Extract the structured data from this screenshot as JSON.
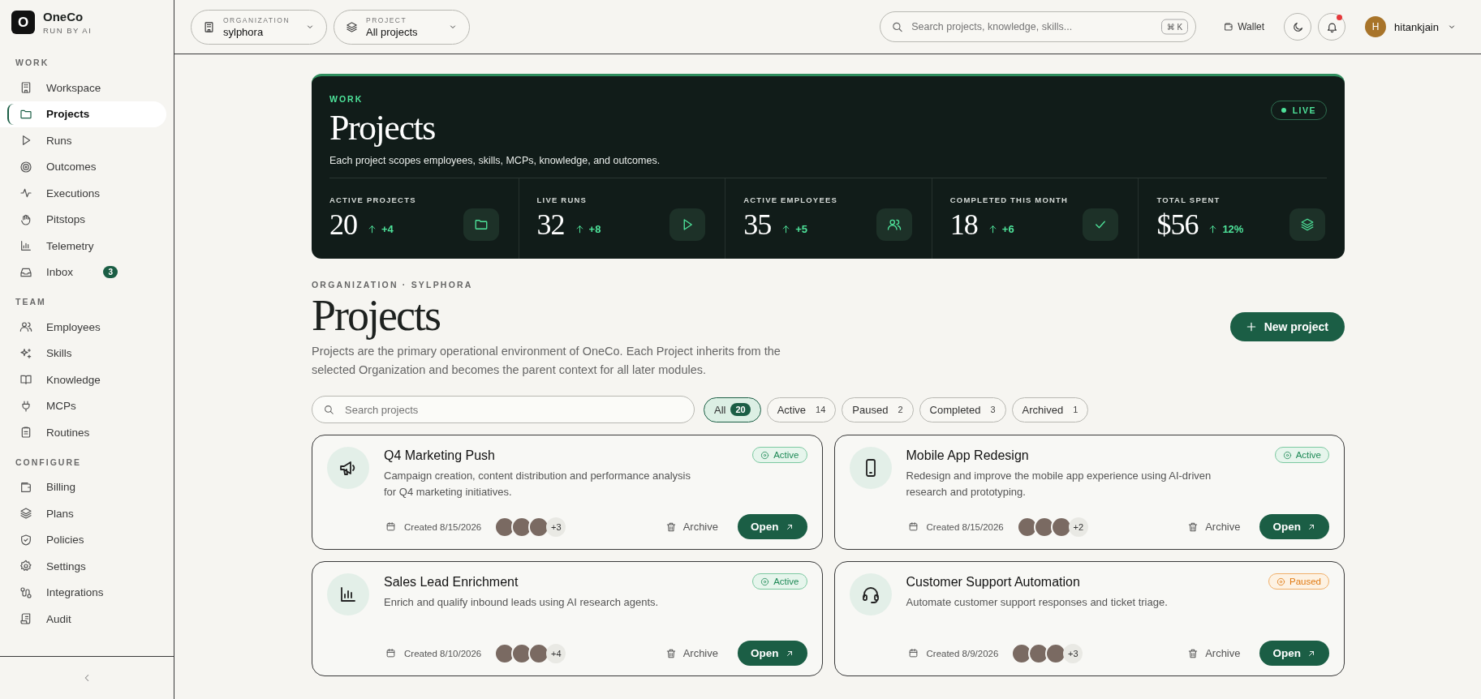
{
  "brand": {
    "name": "OneCo",
    "tagline": "RUN BY AI",
    "logo_letter": "O"
  },
  "sidebar": {
    "sections": [
      {
        "title": "WORK",
        "items": [
          {
            "label": "Workspace",
            "selected": false
          },
          {
            "label": "Projects",
            "selected": true
          },
          {
            "label": "Runs",
            "selected": false
          },
          {
            "label": "Outcomes",
            "selected": false
          },
          {
            "label": "Executions",
            "selected": false
          },
          {
            "label": "Pitstops",
            "selected": false
          },
          {
            "label": "Telemetry",
            "selected": false
          },
          {
            "label": "Inbox",
            "selected": false,
            "badge": "3"
          }
        ]
      },
      {
        "title": "TEAM",
        "items": [
          {
            "label": "Employees",
            "selected": false
          },
          {
            "label": "Skills",
            "selected": false
          },
          {
            "label": "Knowledge",
            "selected": false
          },
          {
            "label": "MCPs",
            "selected": false
          },
          {
            "label": "Routines",
            "selected": false
          }
        ]
      },
      {
        "title": "CONFIGURE",
        "items": [
          {
            "label": "Billing",
            "selected": false
          },
          {
            "label": "Plans",
            "selected": false
          },
          {
            "label": "Policies",
            "selected": false
          },
          {
            "label": "Settings",
            "selected": false
          },
          {
            "label": "Integrations",
            "selected": false
          },
          {
            "label": "Audit",
            "selected": false
          }
        ]
      }
    ]
  },
  "topbar": {
    "organization": {
      "label": "ORGANIZATION",
      "value": "sylphora"
    },
    "project": {
      "label": "PROJECT",
      "value": "All projects"
    },
    "search": {
      "placeholder": "Search projects, knowledge, skills...",
      "shortcut": "⌘ K"
    },
    "wallet": "Wallet",
    "notifications_unread": true,
    "user": {
      "initial": "H",
      "name": "hitankjain"
    }
  },
  "hero": {
    "eyebrow": "WORK",
    "title": "Projects",
    "subtitle": "Each project scopes employees, skills, MCPs, knowledge, and outcomes.",
    "live": "LIVE",
    "stats": [
      {
        "label": "ACTIVE PROJECTS",
        "value": "20",
        "delta": "+4"
      },
      {
        "label": "LIVE RUNS",
        "value": "32",
        "delta": "+8"
      },
      {
        "label": "ACTIVE EMPLOYEES",
        "value": "35",
        "delta": "+5"
      },
      {
        "label": "COMPLETED THIS MONTH",
        "value": "18",
        "delta": "+6"
      },
      {
        "label": "TOTAL SPENT",
        "value": "$56",
        "delta": "12%"
      }
    ]
  },
  "page": {
    "breadcrumb": "ORGANIZATION · SYLPHORA",
    "title": "Projects",
    "description": "Projects are the primary operational environment of OneCo. Each Project inherits from the selected Organization and becomes the parent context for all later modules.",
    "new_button": "New project"
  },
  "search": {
    "placeholder": "Search projects"
  },
  "filters": [
    {
      "label": "All",
      "count": "20",
      "selected": true
    },
    {
      "label": "Active",
      "count": "14",
      "selected": false
    },
    {
      "label": "Paused",
      "count": "2",
      "selected": false
    },
    {
      "label": "Completed",
      "count": "3",
      "selected": false
    },
    {
      "label": "Archived",
      "count": "1",
      "selected": false
    }
  ],
  "projects": [
    {
      "title": "Q4 Marketing Push",
      "description": "Campaign creation, content distribution and performance analysis for Q4 marketing initiatives.",
      "status": "Active",
      "kind": "active",
      "created": "Created 8/15/2026",
      "more": "+3",
      "archive": "Archive",
      "open": "Open"
    },
    {
      "title": "Mobile App Redesign",
      "description": "Redesign and improve the mobile app experience using AI-driven research and prototyping.",
      "status": "Active",
      "kind": "active",
      "created": "Created 8/15/2026",
      "more": "+2",
      "archive": "Archive",
      "open": "Open"
    },
    {
      "title": "Sales Lead Enrichment",
      "description": "Enrich and qualify inbound leads using AI research agents.",
      "status": "Active",
      "kind": "active",
      "created": "Created 8/10/2026",
      "more": "+4",
      "archive": "Archive",
      "open": "Open"
    },
    {
      "title": "Customer Support Automation",
      "description": "Automate customer support responses and ticket triage.",
      "status": "Paused",
      "kind": "paused",
      "created": "Created 8/9/2026",
      "more": "+3",
      "archive": "Archive",
      "open": "Open"
    }
  ]
}
